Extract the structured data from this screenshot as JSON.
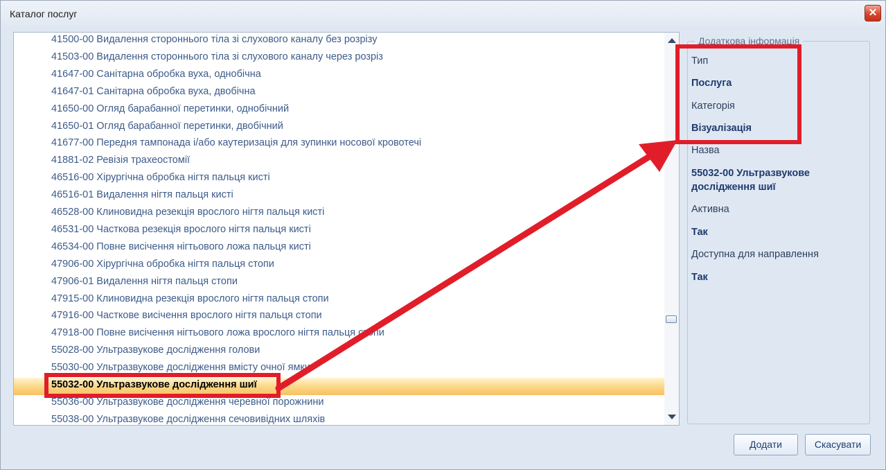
{
  "window": {
    "title": "Каталог послуг",
    "close_glyph": "✕"
  },
  "list": {
    "items": [
      "41500-00 Видалення стороннього тіла зі слухового каналу без розрізу",
      "41503-00 Видалення стороннього тіла зі слухового каналу через розріз",
      "41647-00 Санітарна обробка вуха, однобічна",
      "41647-01 Санітарна обробка вуха, двобічна",
      "41650-00 Огляд барабанної перетинки, однобічний",
      "41650-01 Огляд барабанної перетинки, двобічний",
      "41677-00 Передня тампонада і/або каутеризація для зупинки носової кровотечі",
      "41881-02 Ревізія трахеостомії",
      "46516-00 Хірургічна обробка нігтя пальця кисті",
      "46516-01 Видалення нігтя пальця кисті",
      "46528-00 Клиновидна резекція врослого нігтя пальця кисті",
      "46531-00 Часткова резекція врослого нігтя пальця кисті",
      "46534-00 Повне висічення нігтьового ложа пальця кисті",
      "47906-00 Хірургічна обробка нігтя пальця стопи",
      "47906-01 Видалення нігтя пальця стопи",
      "47915-00 Клиновидна резекція врослого нігтя пальця стопи",
      "47916-00 Часткове висічення врослого нігтя пальця стопи",
      "47918-00 Повне висічення нігтьового ложа врослого нігтя пальця стопи",
      "55028-00 Ультразвукове дослідження голови",
      "55030-00 Ультразвукове дослідження вмісту очної ямки",
      "55032-00 Ультразвукове дослідження шиї",
      "55036-00 Ультразвукове дослідження черевної порожнини",
      "55038-00 Ультразвукове дослідження сечовивідних шляхів"
    ],
    "selected_index": 20,
    "scrollbar": {
      "up_icon": "arrow-up-icon",
      "down_icon": "arrow-down-icon"
    }
  },
  "info": {
    "legend": "Додаткова інформація",
    "type_label": "Тип",
    "type_value": "Послуга",
    "category_label": "Категорія",
    "category_value": "Візуалізація",
    "name_label": "Назва",
    "name_value": "55032-00 Ультразвукове дослідження шиї",
    "active_label": "Активна",
    "active_value": "Так",
    "referral_label": "Доступна для направлення",
    "referral_value": "Так"
  },
  "buttons": {
    "add": "Додати",
    "cancel": "Скасувати"
  },
  "colors": {
    "annotation_red": "#e11d2a",
    "link_text": "#3d5b8a",
    "selection": "#f8c060",
    "window_bg": "#dfe8f2"
  }
}
